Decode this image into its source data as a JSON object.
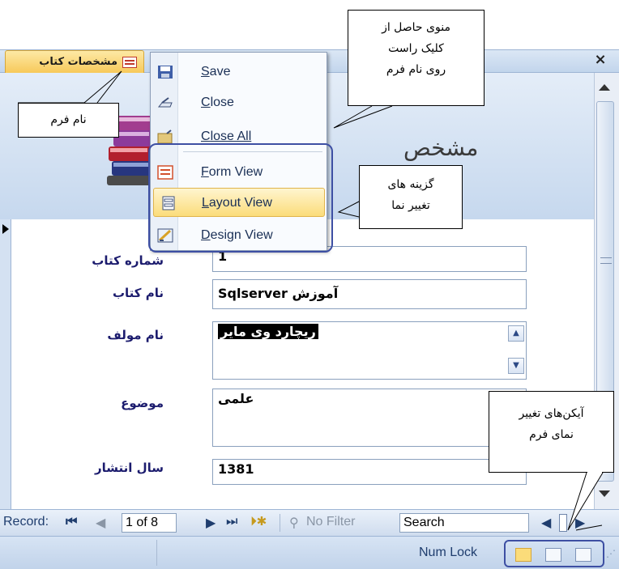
{
  "form_tab": {
    "title": "مشخصات کتاب",
    "close": "×"
  },
  "header": {
    "title": "مشخص"
  },
  "fields": [
    {
      "label": "شماره کتاب",
      "value": "1"
    },
    {
      "label": "نام کتاب",
      "value": "آموزش Sqlserver"
    },
    {
      "label": "نام مولف",
      "value": "ریچارد وی مایر"
    },
    {
      "label": "موضوع",
      "value": "علمی"
    },
    {
      "label": "سال انتشار",
      "value": "1381"
    }
  ],
  "context_menu": {
    "items": [
      {
        "label": "Save",
        "icon": "save-icon"
      },
      {
        "label": "Close",
        "icon": "close-form-icon"
      },
      {
        "label": "Close All",
        "icon": "close-all-icon"
      },
      {
        "label": "Form View",
        "icon": "form-view-icon"
      },
      {
        "label": "Layout View",
        "icon": "layout-view-icon"
      },
      {
        "label": "Design View",
        "icon": "design-view-icon"
      }
    ]
  },
  "navbar": {
    "record_label": "Record:",
    "record_value": "1 of 8",
    "no_filter": "No Filter",
    "search": "Search"
  },
  "statusbar": {
    "num_lock": "Num Lock"
  },
  "callouts": {
    "form_name": "نام فرم",
    "menu_line1": "منوی حاصل از",
    "menu_line2": "کلیک راست",
    "menu_line3": "روی نام فرم",
    "views_line1": "گزینه های",
    "views_line2": "تغییر  نما",
    "icons_line1": "آیکن‌های تغییر",
    "icons_line2": "نمای فرم"
  },
  "colors": {
    "tab_accent": "#f7c95a",
    "highlight": "#3d4fa3",
    "menu_hover": "#fbdc7a"
  }
}
